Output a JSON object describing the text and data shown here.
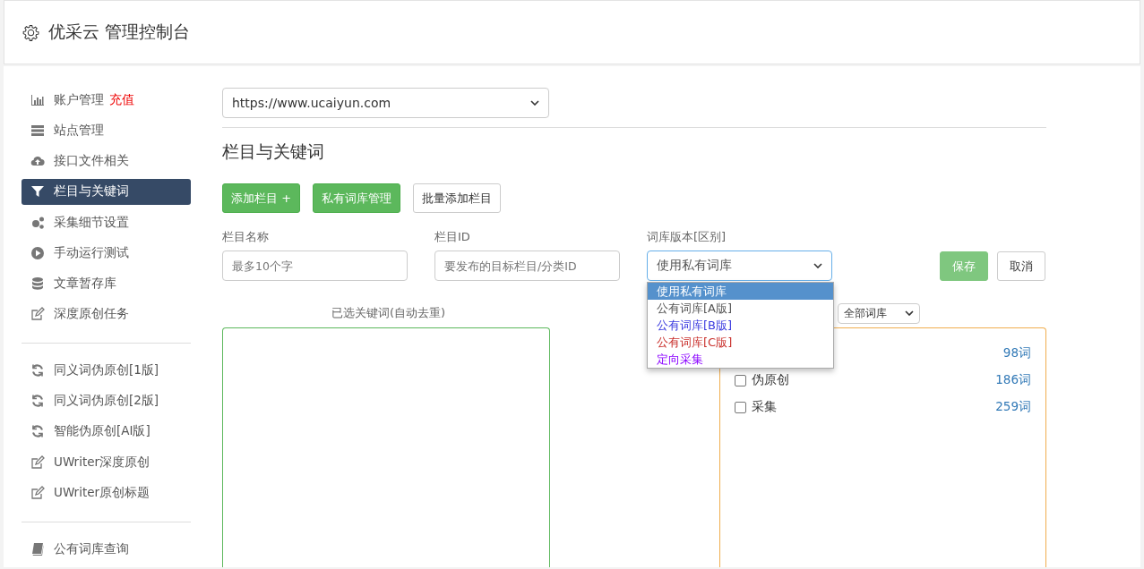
{
  "header": {
    "title": "优采云 管理控制台"
  },
  "sidebar": {
    "groups": [
      {
        "items": [
          {
            "label": "账户管理",
            "badge": "充值",
            "selected": false
          },
          {
            "label": "站点管理",
            "selected": false
          },
          {
            "label": "接口文件相关",
            "selected": false
          },
          {
            "label": "栏目与关键词",
            "selected": true
          },
          {
            "label": "采集细节设置",
            "selected": false
          },
          {
            "label": "手动运行测试",
            "selected": false
          },
          {
            "label": "文章暂存库",
            "selected": false
          },
          {
            "label": "深度原创任务",
            "selected": false
          }
        ]
      },
      {
        "items": [
          {
            "label": "同义词伪原创[1版]",
            "selected": false
          },
          {
            "label": "同义词伪原创[2版]",
            "selected": false
          },
          {
            "label": "智能伪原创[AI版]",
            "selected": false
          },
          {
            "label": "UWriter深度原创",
            "selected": false
          },
          {
            "label": "UWriter原创标题",
            "selected": false
          }
        ]
      },
      {
        "items": [
          {
            "label": "公有词库查询",
            "selected": false
          }
        ]
      }
    ]
  },
  "site_select": {
    "value": "https://www.ucaiyun.com"
  },
  "section_title": "栏目与关键词",
  "buttons": [
    {
      "kind": "primary",
      "label": "添加栏目 +"
    },
    {
      "kind": "primary",
      "label": "私有词库管理"
    },
    {
      "kind": "default",
      "label": "批量添加栏目"
    }
  ],
  "form": {
    "fields": [
      {
        "label": "栏目名称",
        "placeholder": "最多10个字"
      },
      {
        "label": "栏目ID",
        "placeholder": "要发布的目标栏目/分类ID"
      }
    ],
    "library": {
      "label": "词库版本[区别]",
      "value": "使用私有词库",
      "options": [
        {
          "label": "使用私有词库",
          "selected": true
        },
        {
          "label": "公有词库[A版]",
          "selected": false,
          "color": "#555555"
        },
        {
          "label": "公有词库[B版]",
          "selected": false,
          "color": "#3a3adf"
        },
        {
          "label": "公有词库[C版]",
          "selected": false,
          "color": "#c9302c"
        },
        {
          "label": "定向采集",
          "selected": false,
          "color": "#8a00ff"
        }
      ]
    },
    "save": "保存",
    "cancel": "取消"
  },
  "keywords": {
    "label": "已选关键词(自动去重)",
    "filter": "全部词库",
    "libraries": [
      {
        "count": "98词"
      },
      {
        "label": "伪原创",
        "count": "186词",
        "checked": false
      },
      {
        "label": "采集",
        "count": "259词",
        "checked": false
      }
    ]
  }
}
